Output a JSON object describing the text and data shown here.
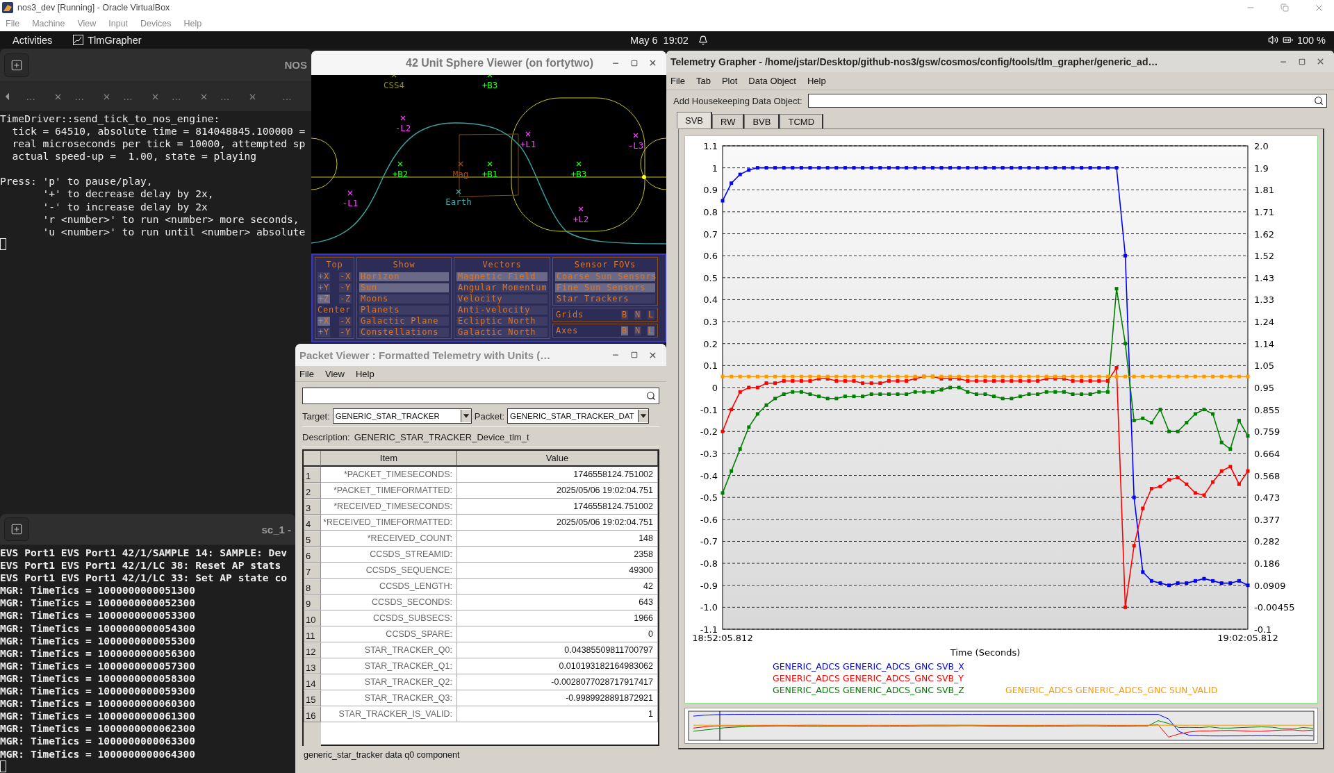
{
  "vm_window": {
    "title": "nos3_dev [Running] - Oracle VirtualBox",
    "menu": [
      "File",
      "Machine",
      "View",
      "Input",
      "Devices",
      "Help"
    ]
  },
  "top_bar": {
    "activities": "Activities",
    "app": "TlmGrapher",
    "clock": "May 6  19:02",
    "battery": "100 %"
  },
  "terminal_top": {
    "title": "NOS",
    "tabs": [
      {
        "label": "…",
        "closable": true
      },
      {
        "label": "…",
        "closable": true
      },
      {
        "label": "…",
        "closable": true
      },
      {
        "label": "…",
        "closable": true
      },
      {
        "label": "…",
        "closable": true
      },
      {
        "label": "…",
        "closable": false
      }
    ],
    "paragraphs": [
      [
        "TimeDriver::send_tick_to_nos_engine:",
        "  tick = 64510, absolute time = 814048845.100000 =",
        "  real microseconds per tick = 10000, attempted sp",
        "  actual speed-up =  1.00, state = playing"
      ],
      [
        "Press: 'p' to pause/play,",
        "       '+' to decrease delay by 2x,",
        "       '-' to increase delay by 2x",
        "       'r <number>' to run <number> more seconds,",
        "       'u <number>' to run until <number> absolute"
      ]
    ]
  },
  "terminal_bottom": {
    "title": "sc_1 -",
    "lines": [
      "EVS Port1 EVS Port1 42/1/SAMPLE 14: SAMPLE: Dev",
      "EVS Port1 EVS Port1 42/1/LC 38: Reset AP stats",
      "EVS Port1 EVS Port1 42/1/LC 33: Set AP state co",
      "MGR: TimeTics = 1000000000051300",
      "MGR: TimeTics = 1000000000052300",
      "MGR: TimeTics = 1000000000053300",
      "MGR: TimeTics = 1000000000054300",
      "MGR: TimeTics = 1000000000055300",
      "MGR: TimeTics = 1000000000056300",
      "MGR: TimeTics = 1000000000057300",
      "MGR: TimeTics = 1000000000058300",
      "MGR: TimeTics = 1000000000059300",
      "MGR: TimeTics = 1000000000060300",
      "MGR: TimeTics = 1000000000061300",
      "MGR: TimeTics = 1000000000062300",
      "MGR: TimeTics = 1000000000063300",
      "MGR: TimeTics = 1000000000064300"
    ]
  },
  "sphere_viewer": {
    "title": "42 Unit Sphere Viewer (on fortytwo)",
    "markers": [
      {
        "label": "CSS4",
        "color": "#8a8a20"
      },
      {
        "label": "+B3",
        "color": "#20ff20"
      },
      {
        "label": "-L2",
        "color": "#ff40ff"
      },
      {
        "label": "+L1",
        "color": "#ff40ff"
      },
      {
        "label": "-L3",
        "color": "#ff40ff"
      },
      {
        "label": "+B2",
        "color": "#20ff20"
      },
      {
        "label": "Mag",
        "color": "#a05020"
      },
      {
        "label": "+B1",
        "color": "#20ff20"
      },
      {
        "label": "+B3",
        "color": "#20ff20"
      },
      {
        "label": "-L1",
        "color": "#ff40ff"
      },
      {
        "label": "Earth",
        "color": "#40a8a8"
      },
      {
        "label": "+L2",
        "color": "#ff40ff"
      }
    ],
    "top": {
      "title": "Top",
      "rows": [
        {
          "kind": "pair",
          "buttons": [
            {
              "label": "+X",
              "selected": false
            },
            {
              "label": "-X",
              "selected": false
            }
          ]
        },
        {
          "kind": "pair",
          "buttons": [
            {
              "label": "+Y",
              "selected": false
            },
            {
              "label": "-Y",
              "selected": false
            }
          ]
        },
        {
          "kind": "pair",
          "buttons": [
            {
              "label": "+Z",
              "selected": true
            },
            {
              "label": "-Z",
              "selected": false
            }
          ]
        },
        {
          "kind": "heading",
          "label": "Center"
        },
        {
          "kind": "pair",
          "buttons": [
            {
              "label": "+X",
              "selected": true
            },
            {
              "label": "-X",
              "selected": false
            }
          ]
        },
        {
          "kind": "pair",
          "buttons": [
            {
              "label": "+Y",
              "selected": false
            },
            {
              "label": "-Y",
              "selected": false
            }
          ]
        }
      ]
    },
    "show": {
      "title": "Show",
      "items": [
        {
          "label": "Horizon",
          "selected": true
        },
        {
          "label": "Sun",
          "selected": true
        },
        {
          "label": "Moons",
          "selected": false
        },
        {
          "label": "Planets",
          "selected": false
        },
        {
          "label": "Galactic Plane",
          "selected": false
        },
        {
          "label": "Constellations",
          "selected": false
        }
      ]
    },
    "vectors": {
      "title": "Vectors",
      "items": [
        {
          "label": "Magnetic Field",
          "selected": true
        },
        {
          "label": "Angular Momentum",
          "selected": false
        },
        {
          "label": "Velocity",
          "selected": false
        },
        {
          "label": "Anti-velocity",
          "selected": false
        },
        {
          "label": "Ecliptic North",
          "selected": false
        },
        {
          "label": "Galactic North",
          "selected": false
        }
      ]
    },
    "sensor_fovs": {
      "title": "Sensor FOVs",
      "items": [
        {
          "label": "Coarse Sun Sensors",
          "selected": true
        },
        {
          "label": "Fine Sun Sensors",
          "selected": true
        },
        {
          "label": "Star Trackers",
          "selected": false
        }
      ]
    },
    "grids": {
      "label": "Grids",
      "buttons": [
        {
          "label": "B",
          "selected": false
        },
        {
          "label": "N",
          "selected": false
        },
        {
          "label": "L",
          "selected": false
        }
      ]
    },
    "axes": {
      "label": "Axes",
      "buttons": [
        {
          "label": "B",
          "selected": true
        },
        {
          "label": "N",
          "selected": false
        },
        {
          "label": "L",
          "selected": true
        }
      ]
    }
  },
  "packet_viewer": {
    "title": "Packet Viewer : Formatted Telemetry with Units (…",
    "menu": [
      "File",
      "View",
      "Help"
    ],
    "target_label": "Target:",
    "target": "GENERIC_STAR_TRACKER",
    "packet_label": "Packet:",
    "packet": "GENERIC_STAR_TRACKER_DAT",
    "description_label": "Description:",
    "description": "GENERIC_STAR_TRACKER_Device_tlm_t",
    "columns": [
      "Item",
      "Value"
    ],
    "rows": [
      {
        "num": "1",
        "item": "*PACKET_TIMESECONDS:",
        "value": "1746558124.751002"
      },
      {
        "num": "2",
        "item": "*PACKET_TIMEFORMATTED:",
        "value": "2025/05/06 19:02:04.751"
      },
      {
        "num": "3",
        "item": "*RECEIVED_TIMESECONDS:",
        "value": "1746558124.751002"
      },
      {
        "num": "4",
        "item": "*RECEIVED_TIMEFORMATTED:",
        "value": "2025/05/06 19:02:04.751"
      },
      {
        "num": "5",
        "item": "*RECEIVED_COUNT:",
        "value": "148"
      },
      {
        "num": "6",
        "item": "CCSDS_STREAMID:",
        "value": "2358"
      },
      {
        "num": "7",
        "item": "CCSDS_SEQUENCE:",
        "value": "49300"
      },
      {
        "num": "8",
        "item": "CCSDS_LENGTH:",
        "value": "42"
      },
      {
        "num": "9",
        "item": "CCSDS_SECONDS:",
        "value": "643"
      },
      {
        "num": "10",
        "item": "CCSDS_SUBSECS:",
        "value": "1966"
      },
      {
        "num": "11",
        "item": "CCSDS_SPARE:",
        "value": "0"
      },
      {
        "num": "12",
        "item": "STAR_TRACKER_Q0:",
        "value": "0.04385509811700797"
      },
      {
        "num": "13",
        "item": "STAR_TRACKER_Q1:",
        "value": "0.010193182164983062"
      },
      {
        "num": "14",
        "item": "STAR_TRACKER_Q2:",
        "value": "-0.0028077028717917417"
      },
      {
        "num": "15",
        "item": "STAR_TRACKER_Q3:",
        "value": "-0.9989928891872921"
      },
      {
        "num": "16",
        "item": "STAR_TRACKER_IS_VALID:",
        "value": "1"
      }
    ],
    "status": "generic_star_tracker data q0 component"
  },
  "grapher": {
    "title": "Telemetry Grapher - /home/jstar/Desktop/github-nos3/gsw/cosmos/config/tools/tlm_grapher/generic_ad…",
    "menu": [
      "File",
      "Tab",
      "Plot",
      "Data Object",
      "Help"
    ],
    "add_label": "Add Housekeeping Data Object:",
    "tabs": [
      {
        "label": "SVB",
        "selected": true
      },
      {
        "label": "RW",
        "selected": false
      },
      {
        "label": "BVB",
        "selected": false
      },
      {
        "label": "TCMD",
        "selected": false
      }
    ],
    "right_axis_ticks": [
      "2.0",
      "1.9",
      "1.81",
      "1.71",
      "1.62",
      "1.52",
      "1.43",
      "1.33",
      "1.24",
      "1.14",
      "1.05",
      "0.95",
      "0.855",
      "0.759",
      "0.664",
      "0.568",
      "0.473",
      "0.377",
      "0.282",
      "0.186",
      "0.0909",
      "-0.00455",
      "-0.1"
    ],
    "chart_data": {
      "type": "line",
      "xlabel": "Time (Seconds)",
      "ylim": [
        -1.1,
        1.1
      ],
      "grid": true,
      "categories": [
        "18:52:05.812",
        null,
        null,
        null,
        null,
        null,
        null,
        null,
        null,
        null,
        null,
        null,
        null,
        null,
        null,
        null,
        null,
        null,
        null,
        null,
        null,
        null,
        null,
        null,
        null,
        null,
        null,
        null,
        null,
        null,
        null,
        null,
        null,
        null,
        null,
        null,
        null,
        null,
        null,
        null,
        null,
        null,
        null,
        null,
        null,
        null,
        null,
        null,
        null,
        null,
        null,
        null,
        null,
        null,
        null,
        null,
        null,
        null,
        null,
        null,
        "19:02:05.812"
      ],
      "yticks": [
        -1.1,
        {
          "value": -1,
          "label": "-1.0"
        },
        -0.9,
        -0.8,
        -0.7,
        -0.6,
        -0.5,
        -0.4,
        -0.3,
        -0.2,
        -0.1,
        0,
        0.1,
        0.2,
        0.3,
        0.4,
        0.5,
        0.6,
        0.7,
        0.8,
        0.9,
        1,
        1.1
      ],
      "series": [
        {
          "name": "GENERIC_ADCS GENERIC_ADCS_GNC SVB_X",
          "color": "#0000ff",
          "marker": "square",
          "values": [
            0.85,
            0.93,
            0.97,
            0.99,
            1,
            1,
            1,
            1,
            1,
            1,
            1,
            1,
            1,
            1,
            1,
            1,
            1,
            1,
            1,
            1,
            1,
            1,
            1,
            1,
            1,
            1,
            1,
            1,
            1,
            1,
            1,
            1,
            1,
            1,
            1,
            1,
            1,
            1,
            1,
            1,
            1,
            1,
            1,
            1,
            1,
            1,
            0.6,
            -0.5,
            -0.84,
            -0.88,
            -0.89,
            -0.9,
            -0.89,
            -0.89,
            -0.88,
            -0.87,
            -0.88,
            -0.89,
            -0.89,
            -0.88,
            -0.9
          ]
        },
        {
          "name": "GENERIC_ADCS GENERIC_ADCS_GNC SVB_Y",
          "color": "#ff0000",
          "marker": "square",
          "values": [
            -0.2,
            -0.1,
            -0.02,
            0,
            0,
            0.02,
            0.02,
            0.03,
            0.03,
            0.03,
            0.03,
            0.04,
            0.04,
            0.03,
            0.03,
            0.03,
            0.02,
            0.02,
            0.02,
            0.03,
            0.03,
            0.03,
            0.04,
            0.05,
            0.05,
            0.04,
            0.04,
            0.04,
            0.03,
            0.03,
            0.03,
            0.03,
            0.03,
            0.03,
            0.03,
            0.03,
            0.03,
            0.04,
            0.04,
            0.04,
            0.03,
            0.03,
            0.03,
            0.03,
            0.03,
            0.09,
            -1.0,
            -0.72,
            -0.55,
            -0.46,
            -0.45,
            -0.42,
            -0.41,
            -0.44,
            -0.48,
            -0.49,
            -0.43,
            -0.38,
            -0.36,
            -0.44,
            -0.38
          ]
        },
        {
          "name": "GENERIC_ADCS GENERIC_ADCS_GNC SVB_Z",
          "color": "#008000",
          "marker": "square",
          "values": [
            -0.48,
            -0.38,
            -0.28,
            -0.18,
            -0.12,
            -0.08,
            -0.05,
            -0.03,
            -0.02,
            -0.02,
            -0.03,
            -0.04,
            -0.05,
            -0.05,
            -0.04,
            -0.04,
            -0.04,
            -0.03,
            -0.03,
            -0.03,
            -0.03,
            -0.03,
            -0.02,
            -0.02,
            -0.02,
            -0.01,
            0,
            0,
            -0.02,
            -0.03,
            -0.03,
            -0.04,
            -0.05,
            -0.05,
            -0.04,
            -0.03,
            -0.03,
            -0.02,
            -0.02,
            -0.02,
            -0.03,
            -0.03,
            -0.03,
            -0.02,
            -0.02,
            0.45,
            0.2,
            -0.15,
            -0.14,
            -0.16,
            -0.1,
            -0.2,
            -0.2,
            -0.16,
            -0.12,
            -0.1,
            -0.12,
            -0.25,
            -0.28,
            -0.15,
            -0.22
          ]
        },
        {
          "name": "GENERIC_ADCS GENERIC_ADCS_GNC SUN_VALID",
          "color": "#ff9900",
          "marker": "square",
          "values": [
            0.05,
            0.05,
            0.05,
            0.05,
            0.05,
            0.05,
            0.05,
            0.05,
            0.05,
            0.05,
            0.05,
            0.05,
            0.05,
            0.05,
            0.05,
            0.05,
            0.05,
            0.05,
            0.05,
            0.05,
            0.05,
            0.05,
            0.05,
            0.05,
            0.05,
            0.05,
            0.05,
            0.05,
            0.05,
            0.05,
            0.05,
            0.05,
            0.05,
            0.05,
            0.05,
            0.05,
            0.05,
            0.05,
            0.05,
            0.05,
            0.05,
            0.05,
            0.05,
            0.05,
            0.05,
            0.05,
            0.05,
            0.05,
            0.05,
            0.05,
            0.05,
            0.05,
            0.05,
            0.05,
            0.05,
            0.05,
            0.05,
            0.05,
            0.05,
            0.05,
            0.05
          ]
        }
      ]
    }
  }
}
